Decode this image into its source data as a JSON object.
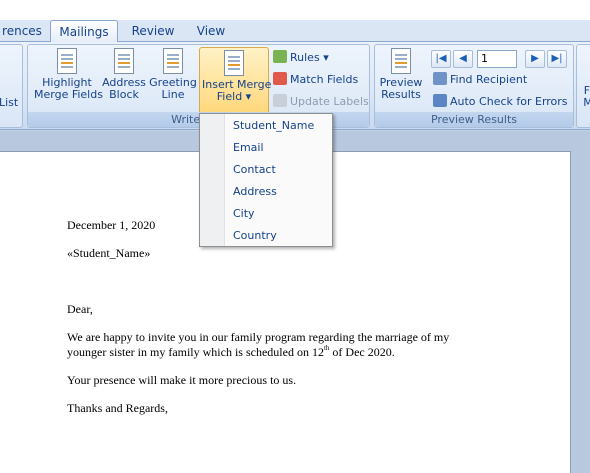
{
  "tabs": [
    {
      "label": "rences"
    },
    {
      "label": "Mailings"
    },
    {
      "label": "Review"
    },
    {
      "label": "View"
    }
  ],
  "ribbon": {
    "start_group": {
      "list_label": "List"
    },
    "write_insert_group": {
      "title": "Write & In",
      "highlight": [
        "Highlight",
        "Merge Fields"
      ],
      "address_block": [
        "Address",
        "Block"
      ],
      "greeting_line": [
        "Greeting",
        "Line"
      ],
      "insert_merge_field": [
        "Insert Merge",
        "Field"
      ],
      "rules": "Rules",
      "match_fields": "Match Fields",
      "update_labels": "Update Labels"
    },
    "preview_group": {
      "title": "Preview Results",
      "preview_results": [
        "Preview",
        "Results"
      ],
      "record_number": "1",
      "find_recipient": "Find Recipient",
      "auto_check": "Auto Check for Errors"
    },
    "finish_group": {
      "label_1": "Fi",
      "label_2": "M"
    }
  },
  "merge_field_menu": {
    "items": [
      "Student_Name",
      "Email",
      "Contact",
      "Address",
      "City",
      "Country"
    ]
  },
  "document": {
    "date": "December 1, 2020",
    "field": "«Student_Name»",
    "greeting": "Dear,",
    "para1_line1": "We are happy to invite you in our family program regarding the marriage of my",
    "para1_line2_pre": "younger sister in my family which is scheduled on 12",
    "para1_sup": "th",
    "para1_line2_post": " of Dec 2020.",
    "para2": "Your presence will  make it more precious to us.",
    "closing": "Thanks and Regards,"
  },
  "colors": {
    "ribbon_text": "#15428b",
    "highlight_button": "#ffd77a",
    "page": "#ffffff",
    "workspace": "#b8c8de"
  }
}
